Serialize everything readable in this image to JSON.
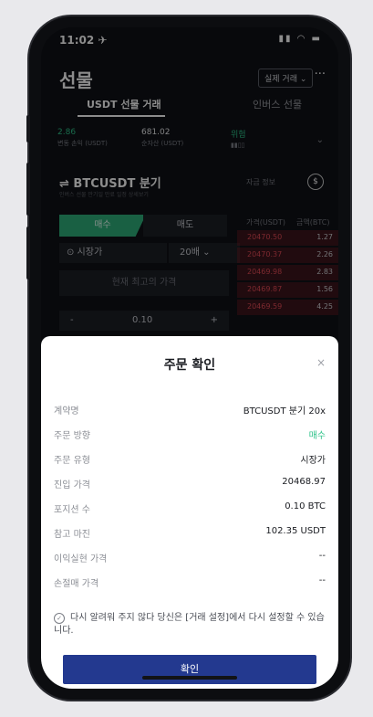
{
  "status": {
    "time": "11:02 ✈",
    "icons": "▮▮ ◠ ▬"
  },
  "header": {
    "title": "선물",
    "trade_select": "실제 거래 ⌄",
    "more": "···"
  },
  "tabs": [
    {
      "label": "USDT 선물 거래"
    },
    {
      "label": "인버스 선물"
    }
  ],
  "stats": [
    {
      "value": "2.86",
      "label": "변동 손익 (USDT)"
    },
    {
      "value": "681.02",
      "label": "순자산 (USDT)"
    },
    {
      "value": "위험",
      "label": "▮▮▯▯"
    }
  ],
  "symbol": {
    "name": "⇌ BTCUSDT 분기",
    "subtitle": "인버스 선물 만기일 만료 일정 상세보기",
    "funding": "자금 정보",
    "info": "$"
  },
  "order": {
    "buy_label": "매수",
    "sell_label": "매도",
    "type": "⊙ 시장가",
    "leverage": "20배 ⌄",
    "price_placeholder": "현재 최고의 가격",
    "minus": "-",
    "qty": "0.10",
    "plus": "+"
  },
  "orderbook": {
    "header_price": "가격(USDT)",
    "header_qty": "금액(BTC)",
    "rows": [
      {
        "price": "20470.50",
        "qty": "1.27"
      },
      {
        "price": "20470.37",
        "qty": "2.26"
      },
      {
        "price": "20469.98",
        "qty": "2.83"
      },
      {
        "price": "20469.87",
        "qty": "1.56"
      },
      {
        "price": "20469.59",
        "qty": "4.25"
      }
    ]
  },
  "dialog": {
    "title": "주문 확인",
    "close": "×",
    "rows": [
      {
        "key": "계약명",
        "value": "BTCUSDT 분기 20x"
      },
      {
        "key": "주문 방향",
        "value": "매수"
      },
      {
        "key": "주문 유형",
        "value": "시장가"
      },
      {
        "key": "진입 가격",
        "value": "20468.97"
      },
      {
        "key": "포지션 수",
        "value": "0.10 BTC"
      },
      {
        "key": "참고 마진",
        "value": "102.35 USDT"
      },
      {
        "key": "이익실현 가격",
        "value": "--"
      },
      {
        "key": "손절매 가격",
        "value": "--"
      }
    ],
    "note": "다시 알려워 주지 않다 당신은 [거래 설정]에서 다시 설정할 수 있습니다.",
    "confirm_label": "확인"
  },
  "colors": {
    "buy_green": "#2fb07a",
    "sell_red": "#e24a55",
    "confirm_blue": "#23398f"
  }
}
